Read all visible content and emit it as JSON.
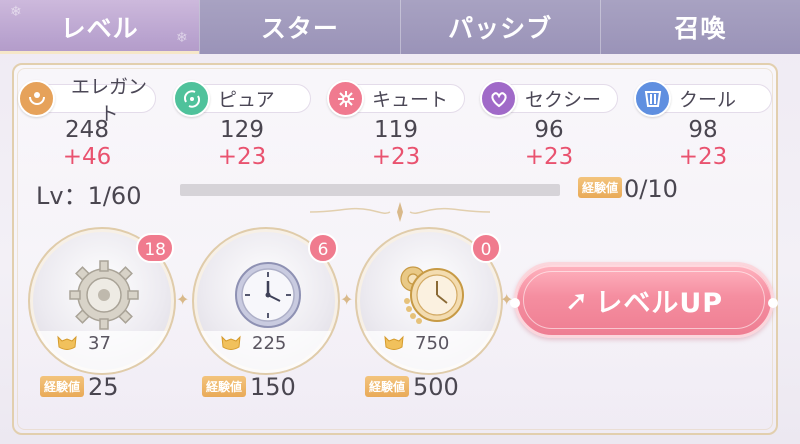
{
  "tabs": [
    {
      "label": "レベル",
      "active": true
    },
    {
      "label": "スター",
      "active": false
    },
    {
      "label": "パッシブ",
      "active": false
    },
    {
      "label": "召喚",
      "active": false
    }
  ],
  "attributes": [
    {
      "name": "エレガント",
      "value": "248",
      "bonus": "+46",
      "icon": "elegant-icon",
      "color": "#e6a25a"
    },
    {
      "name": "ピュア",
      "value": "129",
      "bonus": "+23",
      "icon": "pure-icon",
      "color": "#4fc29b"
    },
    {
      "name": "キュート",
      "value": "119",
      "bonus": "+23",
      "icon": "cute-icon",
      "color": "#f07a8f"
    },
    {
      "name": "セクシー",
      "value": "96",
      "bonus": "+23",
      "icon": "sexy-icon",
      "color": "#a06ac8"
    },
    {
      "name": "クール",
      "value": "98",
      "bonus": "+23",
      "icon": "cool-icon",
      "color": "#5f8fe0"
    }
  ],
  "level": {
    "label": "Lv：1/60",
    "exp_tag": "経験値",
    "exp_value": "0/10",
    "progress": 0.0
  },
  "items": [
    {
      "name": "gear",
      "badge": "18",
      "cost": "37",
      "exp_tag": "経験値",
      "exp": "25"
    },
    {
      "name": "clock",
      "badge": "6",
      "cost": "225",
      "exp_tag": "経験値",
      "exp": "150"
    },
    {
      "name": "pocket-watch",
      "badge": "0",
      "cost": "750",
      "exp_tag": "経験値",
      "exp": "500"
    }
  ],
  "level_up_button": {
    "label": "レベルUP"
  },
  "colors": {
    "tab_bg": "#9a93b8",
    "tab_active": "#b9a3cf",
    "accent_pink": "#e9526f",
    "gold_border": "#e2cfae"
  }
}
